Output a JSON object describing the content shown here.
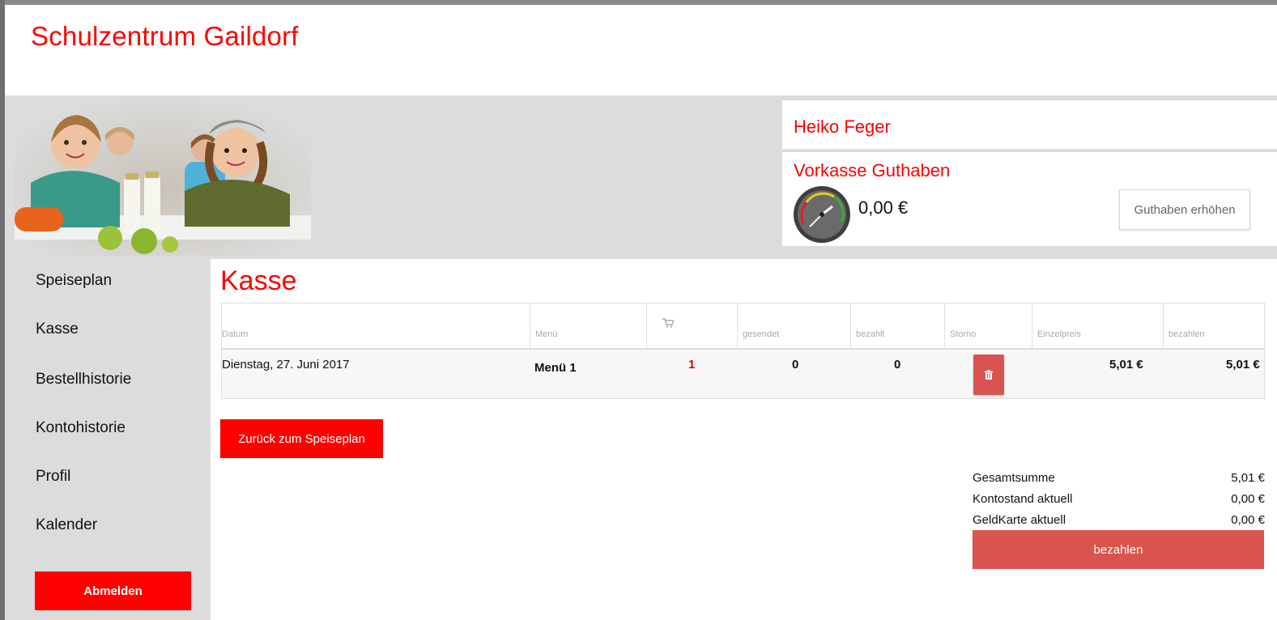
{
  "header": {
    "site_title": "Schulzentrum Gaildorf"
  },
  "user": {
    "name": "Heiko Feger"
  },
  "credit": {
    "title": "Vorkasse Guthaben",
    "value": "0,00 €",
    "button_label": "Guthaben erhöhen"
  },
  "sidebar": {
    "items": [
      {
        "label": "Speiseplan"
      },
      {
        "label": "Kasse"
      },
      {
        "label": "Bestellhistorie"
      },
      {
        "label": "Kontohistorie"
      },
      {
        "label": "Profil"
      },
      {
        "label": "Kalender"
      }
    ],
    "logout_label": "Abmelden"
  },
  "main": {
    "title": "Kasse",
    "table": {
      "headers": [
        "Datum",
        "Menü",
        "",
        "gesendet",
        "bezahlt",
        "Storno",
        "Einzelpreis",
        "bezahlen"
      ],
      "rows": [
        {
          "datum": "Dienstag, 27. Juni 2017",
          "menu": "Menü 1",
          "anzahl": "1",
          "gesendet": "0",
          "bezahlt": "0",
          "einzelpreis": "5,01 €",
          "bezahlen": "5,01 €"
        }
      ]
    },
    "back_button_label": "Zurück zum Speiseplan",
    "summary": {
      "gesamtsumme_label": "Gesamtsumme",
      "gesamtsumme_value": "5,01 €",
      "kontostand_label": "Kontostand aktuell",
      "kontostand_value": "0,00 €",
      "geldkarte_label": "GeldKarte aktuell",
      "geldkarte_value": "0,00 €"
    },
    "pay_button_label": "bezahlen"
  },
  "colors": {
    "brand_red": "#ff0000",
    "danger_red": "#d9534f",
    "panel_grey": "#dcdcdc"
  },
  "icons": [
    "cart-icon",
    "trash-icon",
    "gauge-icon"
  ]
}
